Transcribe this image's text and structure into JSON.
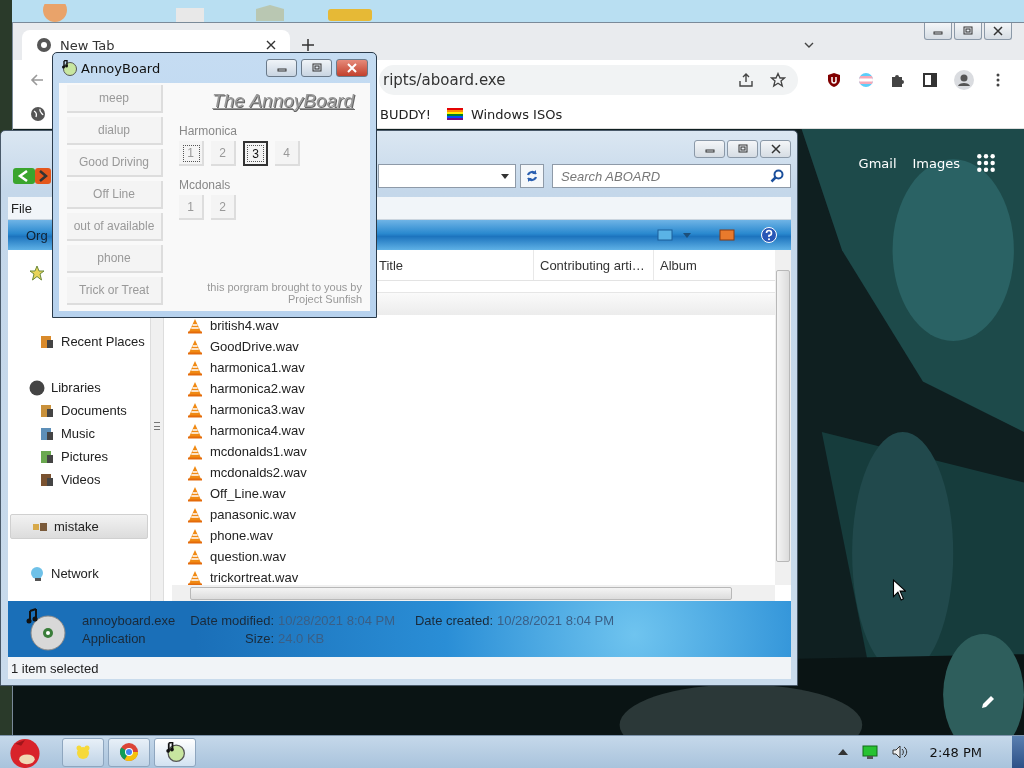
{
  "browser": {
    "tab": {
      "title": "New Tab",
      "selected": true
    },
    "address": "ripts/aboard.exe",
    "bookmarks": [
      {
        "label": "BUDDY!",
        "kind": "plain"
      },
      {
        "label": "Windows ISOs",
        "kind": "flag"
      }
    ],
    "links": [
      "Gmail",
      "Images"
    ]
  },
  "explorer": {
    "menu": [
      "File"
    ],
    "toolbar": [
      "Org"
    ],
    "search": {
      "placeholder": "Search ABOARD"
    },
    "nav": [
      {
        "kind": "favorites",
        "children": [
          {
            "label": "Recent Places",
            "selected": false
          }
        ]
      },
      {
        "kind": "libraries",
        "label": "Libraries",
        "selected": false,
        "children": [
          {
            "label": "Documents",
            "selected": false
          },
          {
            "label": "Music",
            "selected": false
          },
          {
            "label": "Pictures",
            "selected": false
          },
          {
            "label": "Videos",
            "selected": false
          }
        ]
      },
      {
        "kind": "homegroup",
        "label": "mistake",
        "selected": true
      },
      {
        "kind": "network",
        "label": "Network",
        "selected": false
      }
    ],
    "columns": [
      "Title",
      "Contributing arti…",
      "Album"
    ],
    "files": [
      "british4.wav",
      "GoodDrive.wav",
      "harmonica1.wav",
      "harmonica2.wav",
      "harmonica3.wav",
      "harmonica4.wav",
      "mcdonalds1.wav",
      "mcdonalds2.wav",
      "Off_Line.wav",
      "panasonic.wav",
      "phone.wav",
      "question.wav",
      "trickortreat.wav"
    ],
    "details": {
      "name": "annoyboard.exe",
      "type": "Application",
      "modified_label": "Date modified:",
      "modified": "10/28/2021 8:04 PM",
      "created_label": "Date created:",
      "created": "10/28/2021 8:04 PM",
      "size_label": "Size:",
      "size": "24.0 KB"
    },
    "status": "1 item selected"
  },
  "annoyboard": {
    "title": "AnnoyBoard",
    "heading": "The AnnoyBoard",
    "sounds": [
      "meep",
      "dialup",
      "Good Driving",
      "Off Line",
      "out of available",
      "phone",
      "Trick or Treat"
    ],
    "groups": [
      {
        "label": "Harmonica",
        "buttons": [
          {
            "label": "1",
            "focused": true,
            "pressed": false
          },
          {
            "label": "2",
            "focused": false,
            "pressed": false
          },
          {
            "label": "3",
            "focused": true,
            "pressed": true
          },
          {
            "label": "4",
            "focused": false,
            "pressed": false
          }
        ]
      },
      {
        "label": "Mcdonals",
        "buttons": [
          {
            "label": "1",
            "focused": false,
            "pressed": false
          },
          {
            "label": "2",
            "focused": false,
            "pressed": false
          }
        ]
      }
    ],
    "credit": "this porgram brought to yous by Project Sunfish"
  },
  "taskbar": {
    "clock": "2:48 PM"
  }
}
